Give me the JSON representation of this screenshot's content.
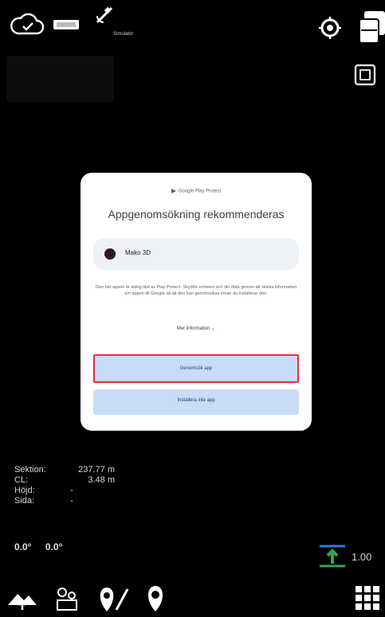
{
  "statusbar": {
    "gps_label": "Simulator"
  },
  "dialog": {
    "provider": "Google Play Protect",
    "title": "Appgenomsökning rekommenderas",
    "app_name": "Mako 3D",
    "description": "Den här appen är aldrig läst av Play Protect. Skydda enheten och din data genom att skicka information om appen till Google så att den kan genomsökas innan du installerar den.",
    "more_info": "Mer information",
    "scan_button": "Genomsök app",
    "install_button": "Installera inte app"
  },
  "readouts": {
    "section_label": "Sektion:",
    "section_value": "237.77 m",
    "cl_label": "CL:",
    "cl_value": "3.48 m",
    "height_label": "Höjd:",
    "height_value": "-",
    "side_label": "Sida:",
    "side_value": "-"
  },
  "angles": {
    "first": "0.0°",
    "second": "0.0°"
  },
  "scale": {
    "value": "1.00"
  },
  "colors": {
    "background": "#000000",
    "dialog_bg": "#ffffff",
    "button_bg": "#c8dcf7",
    "highlight_border": "#e0303c",
    "scale_green": "#2fa84f",
    "scale_blue": "#2a7de1"
  },
  "icons": {
    "cloud": "cloud-check-icon",
    "rtk": "receiver-icon",
    "satellite": "satellite-icon",
    "locate": "target-icon",
    "layers": "layers-icon",
    "screenshot": "capture-icon",
    "terrain": "terrain-icon",
    "level": "level-icon",
    "route": "route-pin-icon",
    "pin": "pin-icon",
    "grid": "grid-icon"
  }
}
